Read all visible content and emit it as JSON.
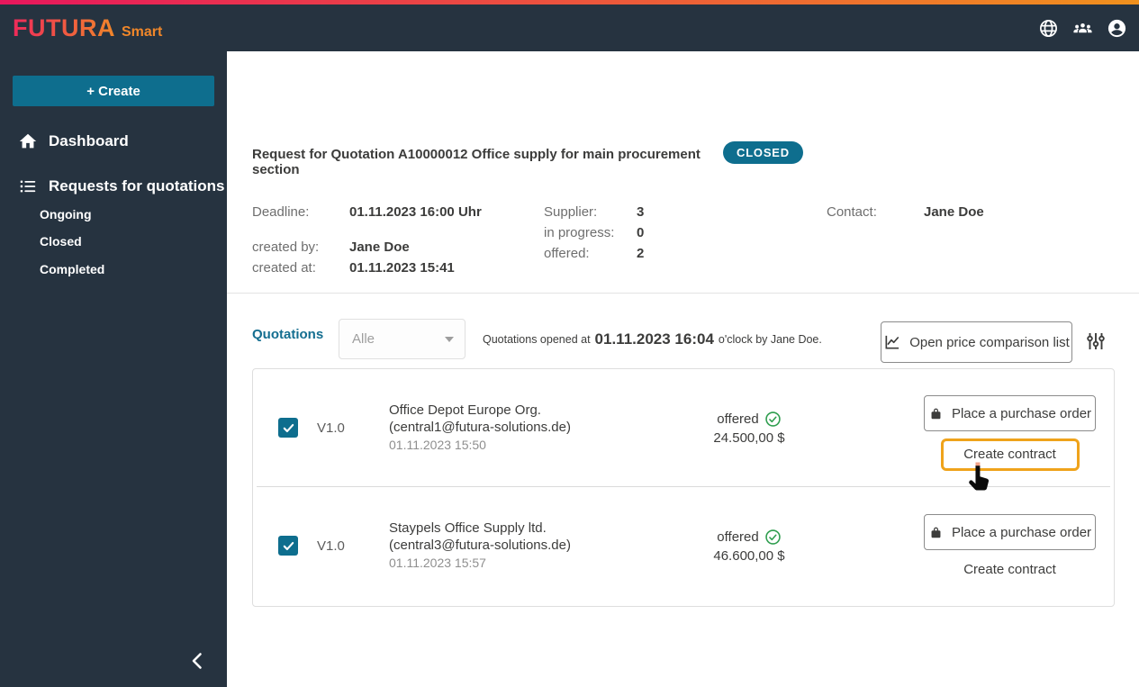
{
  "brand": {
    "name": "FUTURA",
    "suffix": "Smart"
  },
  "header": {
    "icons": [
      "globe-icon",
      "users-icon",
      "account-icon"
    ]
  },
  "sidebar": {
    "create_label": "+ Create",
    "dashboard_label": "Dashboard",
    "requests_label": "Requests for quotations",
    "sub_items": [
      "Ongoing",
      "Closed",
      "Completed"
    ]
  },
  "page": {
    "title": "Request for Quotation A10000012 Office supply for main procurement section",
    "status_badge": "CLOSED"
  },
  "details": {
    "deadline_label": "Deadline:",
    "deadline_value": "01.11.2023 16:00 Uhr",
    "created_by_label": "created by:",
    "created_by_value": "Jane Doe",
    "created_at_label": "created at:",
    "created_at_value": "01.11.2023 15:41",
    "supplier_label": "Supplier:",
    "supplier_value": "3",
    "in_progress_label": "in progress:",
    "in_progress_value": "0",
    "offered_label": "offered:",
    "offered_value": "2",
    "contact_label": "Contact:",
    "contact_value": "Jane Doe"
  },
  "quotations": {
    "section_label": "Quotations",
    "filter_value": "Alle",
    "opened_prefix": "Quotations opened at",
    "opened_datetime": "01.11.2023 16:04",
    "opened_suffix": "o'clock by Jane Doe.",
    "price_comparison_label": "Open price comparison list",
    "rows": [
      {
        "version": "V1.0",
        "supplier_name": "Office Depot Europe Org.",
        "supplier_email": "(central1@futura-solutions.de)",
        "submitted_at": "01.11.2023 15:50",
        "status": "offered",
        "amount": "24.500,00 $",
        "purchase_label": "Place a purchase order",
        "contract_label": "Create contract"
      },
      {
        "version": "V1.0",
        "supplier_name": "Staypels Office Supply ltd.",
        "supplier_email": "(central3@futura-solutions.de)",
        "submitted_at": "01.11.2023 15:57",
        "status": "offered",
        "amount": "46.600,00 $",
        "purchase_label": "Place a purchase order",
        "contract_label": "Create contract"
      }
    ]
  },
  "colors": {
    "accent_teal": "#0e6e8e",
    "dark_bar": "#263340",
    "brand_gradient_start": "#e8175d",
    "brand_gradient_end": "#f0911d",
    "highlight_orange": "#efa31b",
    "success_green": "#2f9e4f"
  }
}
